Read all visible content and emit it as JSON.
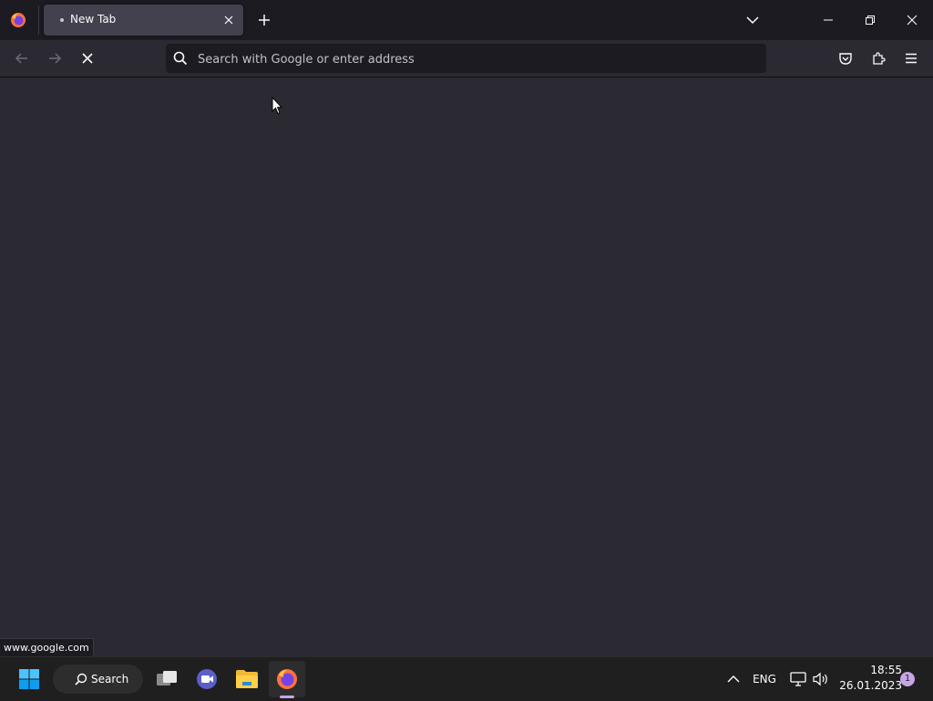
{
  "browser": {
    "tab": {
      "title": "New Tab"
    },
    "urlbar": {
      "placeholder": "Search with Google or enter address",
      "value": ""
    },
    "status_link": "www.google.com"
  },
  "taskbar": {
    "search_label": "Search",
    "language": "ENG",
    "time": "18:55",
    "date": "26.01.2023",
    "notification_count": "1"
  },
  "colors": {
    "chrome_dark": "#1c1b22",
    "content_bg": "#2b2a33",
    "tab_selected": "#42414d",
    "taskbar_bg": "#1f1f1f",
    "accent": "#c8a5e8"
  },
  "icons": {
    "firefox": "firefox-icon",
    "tab_close": "close-icon",
    "new_tab": "plus-icon",
    "list_tabs": "chevron-down-icon",
    "minimize": "minimize-icon",
    "restore": "restore-icon",
    "close_window": "close-icon",
    "back": "arrow-left-icon",
    "forward": "arrow-right-icon",
    "stop": "stop-icon",
    "search": "search-icon",
    "pocket": "pocket-icon",
    "extensions": "puzzle-icon",
    "menu": "hamburger-icon"
  }
}
